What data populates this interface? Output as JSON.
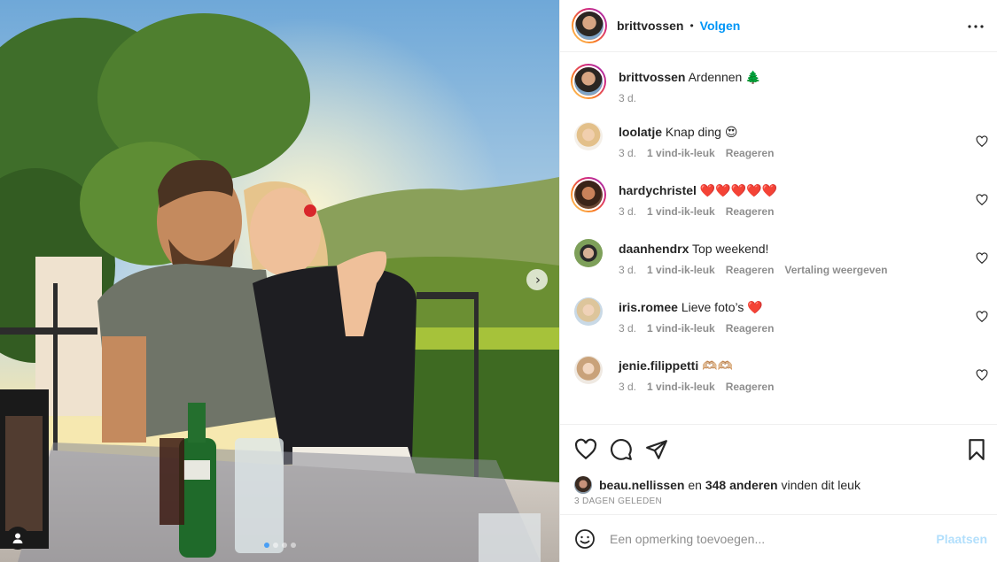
{
  "post": {
    "author": "brittvossen",
    "follow_label": "Volgen",
    "separator": "•",
    "caption": {
      "username": "brittvossen",
      "text": "Ardennen 🌲",
      "age": "3 d."
    }
  },
  "comments": [
    {
      "username": "loolatje",
      "text": "Knap ding 😍",
      "age": "3 d.",
      "likes": "1 vind-ik-leuk",
      "reply": "Reageren",
      "translate": ""
    },
    {
      "username": "hardychristel",
      "text": "❤️❤️❤️❤️❤️",
      "age": "3 d.",
      "likes": "1 vind-ik-leuk",
      "reply": "Reageren",
      "translate": ""
    },
    {
      "username": "daanhendrx",
      "text": "Top weekend!",
      "age": "3 d.",
      "likes": "1 vind-ik-leuk",
      "reply": "Reageren",
      "translate": "Vertaling weergeven"
    },
    {
      "username": "iris.romee",
      "text": "Lieve foto’s ❤️",
      "age": "3 d.",
      "likes": "1 vind-ik-leuk",
      "reply": "Reageren",
      "translate": ""
    },
    {
      "username": "jenie.filippetti",
      "text": "🫶🏼🫶🏼",
      "age": "3 d.",
      "likes": "1 vind-ik-leuk",
      "reply": "Reageren",
      "translate": ""
    }
  ],
  "likes": {
    "first_user": "beau.nellissen",
    "connector": "en",
    "others": "348 anderen",
    "suffix": "vinden dit leuk"
  },
  "date_label": "3 DAGEN GELEDEN",
  "comment_box": {
    "placeholder": "Een opmerking toevoegen...",
    "post_label": "Plaatsen"
  },
  "carousel": {
    "slides": 4,
    "active": 1
  },
  "colors": {
    "accent": "#0095f6",
    "post_disabled": "#b2dffc",
    "muted": "#8e8e8e"
  }
}
